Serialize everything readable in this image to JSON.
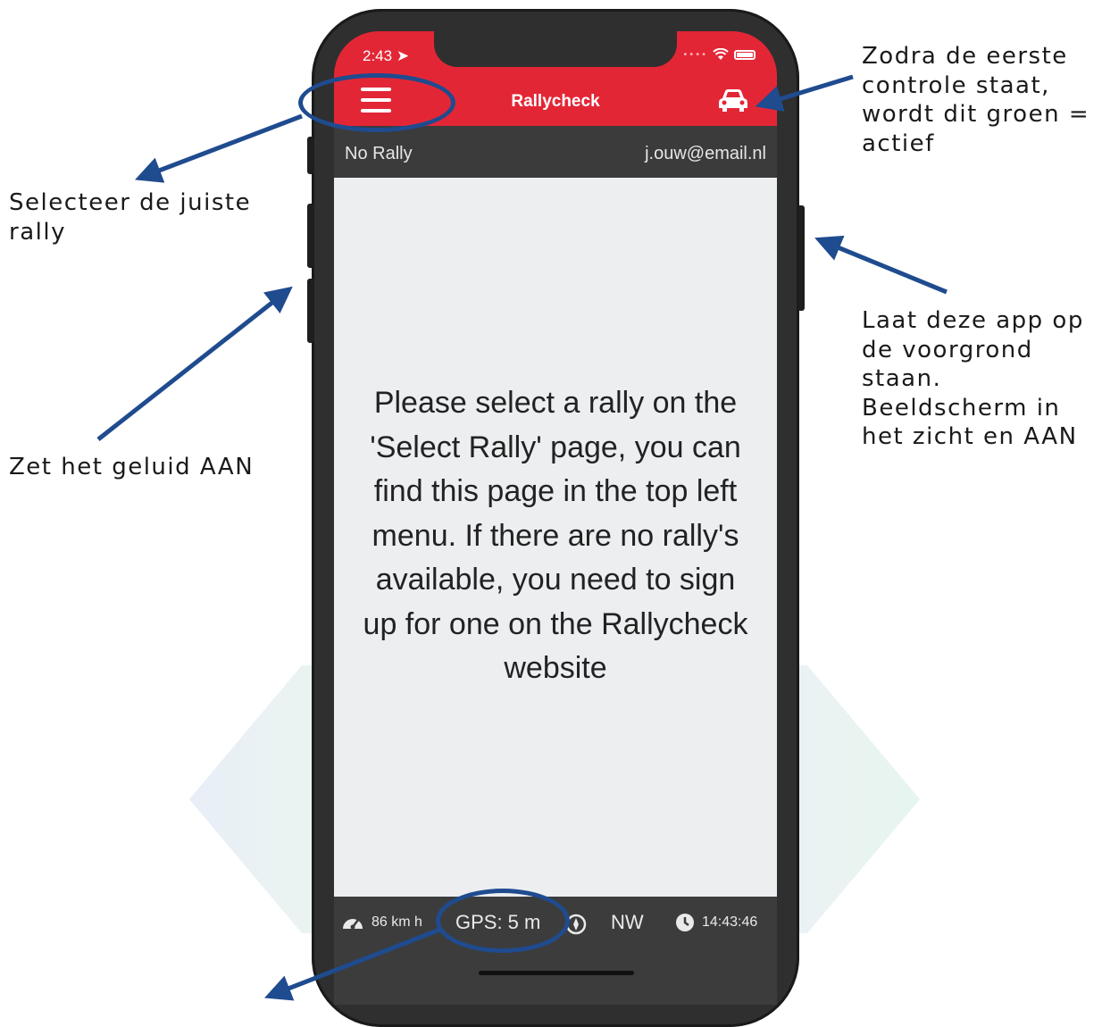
{
  "status_bar": {
    "time": "2:43"
  },
  "app": {
    "title": "Rallycheck"
  },
  "subbar": {
    "rally": "No Rally",
    "email": "j.ouw@email.nl"
  },
  "content": {
    "message": "Please select a rally on the 'Select Rally' page, you can find this page in the top left menu. If there are no rally's available, you need to sign up for one on the Rallycheck website"
  },
  "footer": {
    "speed": "86 km h",
    "gps": "GPS: 5 m",
    "direction": "NW",
    "clock": "14:43:46"
  },
  "annotations": {
    "top_right": "Zodra de eerste controle staat, wordt dit groen = actief",
    "left_top": "Selecteer de juiste rally",
    "left_middle": "Zet het geluid AAN",
    "right_middle": "Laat deze app op de voorgrond staan. Beeldscherm in het zicht en AAN"
  },
  "colors": {
    "header": "#e32636",
    "annotation": "#1f4b8f"
  },
  "icons": [
    "menu-icon",
    "car-icon",
    "wifi-icon",
    "battery-icon",
    "speedometer-icon",
    "compass-icon",
    "clock-icon"
  ]
}
